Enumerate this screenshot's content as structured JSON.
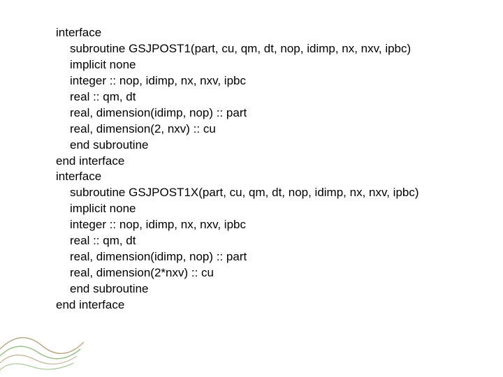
{
  "code": {
    "block1": {
      "l0": "interface",
      "l1": "subroutine GSJPOST1(part, cu, qm, dt, nop, idimp, nx, nxv, ipbc)",
      "l2": "implicit none",
      "l3": "integer :: nop, idimp, nx, nxv, ipbc",
      "l4": "real :: qm, dt",
      "l5": "real, dimension(idimp, nop) :: part",
      "l6": "real, dimension(2, nxv) :: cu",
      "l7": "end subroutine",
      "l8": "end interface"
    },
    "block2": {
      "l0": "interface",
      "l1": "subroutine GSJPOST1X(part, cu, qm, dt, nop, idimp, nx, nxv, ipbc)",
      "l2": "implicit none",
      "l3": "integer :: nop, idimp, nx, nxv, ipbc",
      "l4": "real :: qm, dt",
      "l5": "real, dimension(idimp, nop) :: part",
      "l6": "real, dimension(2*nxv) :: cu",
      "l7": "end subroutine",
      "l8": "end interface"
    }
  }
}
